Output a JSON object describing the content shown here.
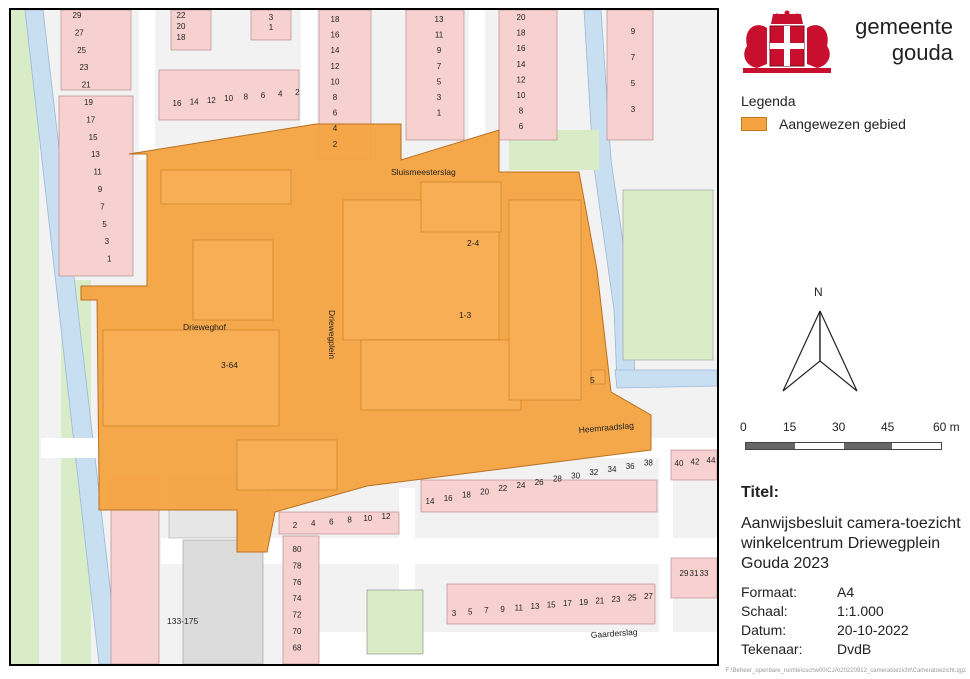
{
  "logo": {
    "name_line1": "gemeente",
    "name_line2": "gouda"
  },
  "legend": {
    "title": "Legenda",
    "items": [
      {
        "label": "Aangewezen gebied",
        "color": "#f4a340"
      }
    ]
  },
  "north_arrow": {
    "label": "N"
  },
  "scalebar": {
    "ticks": [
      "0",
      "15",
      "30",
      "45",
      "60 m"
    ]
  },
  "info": {
    "title": "Titel:",
    "description": "Aanwijsbesluit camera-toezicht winkelcentrum Driewegplein Gouda 2023",
    "rows": [
      {
        "key": "Formaat:",
        "value": "A4"
      },
      {
        "key": "Schaal:",
        "value": "1:1.000"
      },
      {
        "key": "Datum:",
        "value": "20-10-2022"
      },
      {
        "key": "Tekenaar:",
        "value": "DvdB"
      }
    ]
  },
  "footer_path": "F:\\Beheer_openbare_ruimte\\cschw00\\CJA\\20220912_cameratoezicht\\Cameratoezicht.qgz",
  "map": {
    "colors": {
      "area": "#f4a340",
      "building": "#f7d0d0",
      "water": "#c8dff2",
      "green": "#d8ecc8",
      "road": "#ffffff"
    },
    "streets": [
      "Sluismeesterslag",
      "Driewegplein",
      "Heemraadslag",
      "Gaarderslag"
    ],
    "building_labels": [
      "Drieweghof",
      "3-64",
      "2-4",
      "1-3",
      "5",
      "133-175"
    ],
    "numbers": {
      "col_a": [
        "29",
        "27",
        "25",
        "23",
        "21",
        "19",
        "17",
        "15",
        "13",
        "11",
        "9",
        "7",
        "5",
        "3",
        "1"
      ],
      "row_b": [
        "16",
        "14",
        "12",
        "10",
        "8",
        "6",
        "4",
        "2"
      ],
      "col_c": [
        "18",
        "16",
        "14",
        "12",
        "10",
        "8",
        "6",
        "4",
        "2"
      ],
      "col_d": [
        "13",
        "11",
        "9",
        "7",
        "5",
        "3",
        "1"
      ],
      "col_e": [
        "20",
        "18",
        "16",
        "14",
        "12",
        "10",
        "8",
        "6"
      ],
      "col_f": [
        "9",
        "7",
        "5",
        "3"
      ],
      "top_g": [
        "22",
        "20",
        "18"
      ],
      "top_h": [
        "3",
        "1"
      ],
      "row_i": [
        "14",
        "16",
        "18",
        "20",
        "22",
        "24",
        "26",
        "28",
        "30",
        "32",
        "34",
        "36",
        "38"
      ],
      "row_j": [
        "40",
        "42",
        "44"
      ],
      "row_k": [
        "2",
        "4",
        "6",
        "8",
        "10",
        "12"
      ],
      "col_l": [
        "80",
        "78",
        "76",
        "74",
        "72",
        "70",
        "68"
      ],
      "row_m": [
        "3",
        "5",
        "7",
        "9",
        "11",
        "13",
        "15",
        "17",
        "19",
        "21",
        "23",
        "25",
        "27"
      ],
      "row_n": [
        "29",
        "31",
        "33"
      ]
    }
  }
}
